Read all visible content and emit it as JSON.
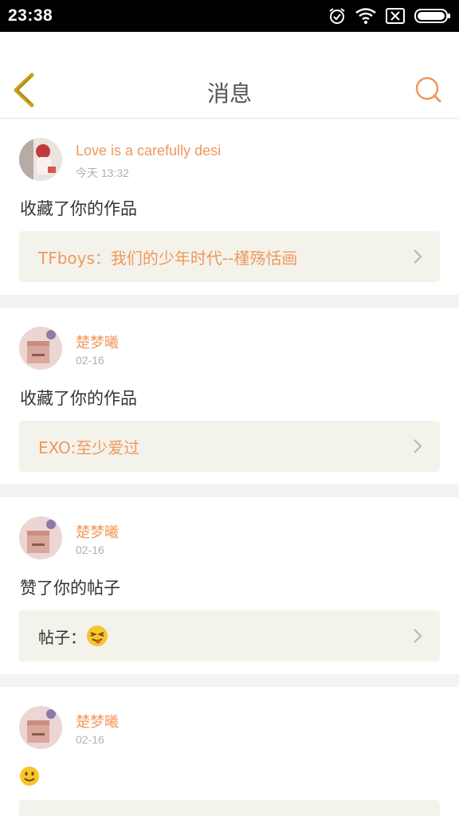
{
  "status_bar": {
    "time": "23:38"
  },
  "header": {
    "title": "消息"
  },
  "messages": [
    {
      "user": "Love is a carefully desi",
      "time": "今天 13:32",
      "action": "收藏了你的作品",
      "target": "TFboys：我们的少年时代--槿殇恬画"
    },
    {
      "user": "楚梦曦",
      "time": "02-16",
      "action": "收藏了你的作品",
      "target": "EXO:至少爱过"
    },
    {
      "user": "楚梦曦",
      "time": "02-16",
      "action": "赞了你的帖子",
      "target": "帖子："
    },
    {
      "user": "楚梦曦",
      "time": "02-16"
    }
  ],
  "colors": {
    "accent": "#f0985b",
    "card_bg": "#f3f3ec",
    "back_arrow": "#c9a21a"
  }
}
